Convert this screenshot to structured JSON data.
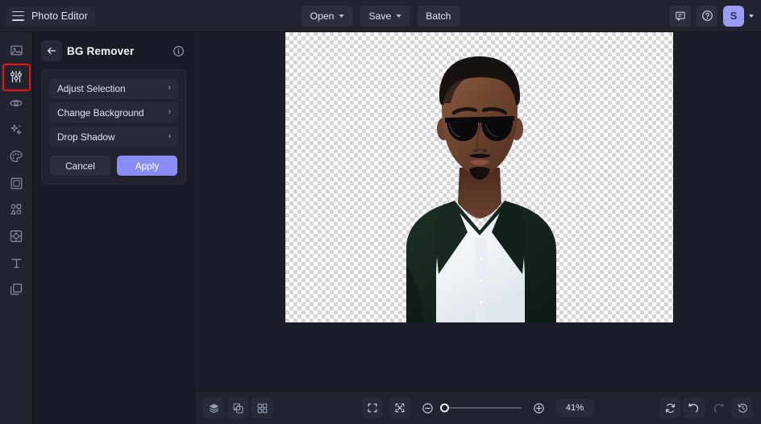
{
  "app": {
    "title": "Photo Editor",
    "accent_color": "#8a8cf5",
    "highlight_color": "#ee1111",
    "topbar_bg": "#21242f",
    "panel_bg": "#191c26",
    "canvas_bg": "#1b1e29"
  },
  "topbar": {
    "menu_icon": "hamburger-icon",
    "buttons": [
      {
        "label": "Open",
        "has_caret": true,
        "icon": "chevron-down-icon"
      },
      {
        "label": "Save",
        "has_caret": true,
        "icon": "chevron-down-icon"
      },
      {
        "label": "Batch",
        "has_caret": false,
        "icon": ""
      }
    ],
    "right_icons": [
      {
        "name": "feedback-icon"
      },
      {
        "name": "help-icon"
      }
    ],
    "avatar": {
      "initial": "S",
      "color": "#9a9cf7"
    }
  },
  "sidebar": {
    "selected_index": 1,
    "items": [
      {
        "name": "sidebar-item-image",
        "icon": "image-icon",
        "label": "Image"
      },
      {
        "name": "sidebar-item-adjust",
        "icon": "sliders-icon",
        "label": "Adjust"
      },
      {
        "name": "sidebar-item-retouch",
        "icon": "eye-icon",
        "label": "Retouch"
      },
      {
        "name": "sidebar-item-effects",
        "icon": "sparkles-icon",
        "label": "Effects"
      },
      {
        "name": "sidebar-item-color",
        "icon": "palette-icon",
        "label": "Color"
      },
      {
        "name": "sidebar-item-frame",
        "icon": "frame-icon",
        "label": "Frame"
      },
      {
        "name": "sidebar-item-shapes",
        "icon": "shapes-icon",
        "label": "Shapes"
      },
      {
        "name": "sidebar-item-overlay",
        "icon": "overlay-icon",
        "label": "Overlay"
      },
      {
        "name": "sidebar-item-text",
        "icon": "text-icon",
        "label": "Text"
      },
      {
        "name": "sidebar-item-layers",
        "icon": "layers-icon",
        "label": "Layers"
      }
    ]
  },
  "panel": {
    "back_icon": "back-arrow-icon",
    "title": "BG Remover",
    "info_icon": "info-icon",
    "options": [
      {
        "label": "Adjust Selection",
        "chevron": "›"
      },
      {
        "label": "Change Background",
        "chevron": "›"
      },
      {
        "label": "Drop Shadow",
        "chevron": "›"
      }
    ],
    "cancel_label": "Cancel",
    "apply_label": "Apply"
  },
  "canvas": {
    "transparency_checker": true,
    "subject_description": "Man wearing sunglasses, white polo shirt and dark green jacket"
  },
  "bottombar": {
    "left_icons": [
      {
        "name": "layers-stack-icon",
        "boxed": true
      },
      {
        "name": "compare-icon",
        "boxed": true
      },
      {
        "name": "grid-icon",
        "boxed": true
      }
    ],
    "view_icons": [
      {
        "name": "fit-screen-icon"
      },
      {
        "name": "actual-size-icon"
      }
    ],
    "zoom_out_icon": "zoom-out-icon",
    "zoom_in_icon": "zoom-in-icon",
    "zoom_value": "41%",
    "slider_position_pct": 0,
    "right_icons": [
      {
        "name": "reset-icon",
        "disabled": false
      },
      {
        "name": "undo-icon",
        "disabled": false
      },
      {
        "name": "redo-icon",
        "disabled": true
      },
      {
        "name": "history-icon",
        "disabled": false
      }
    ]
  }
}
